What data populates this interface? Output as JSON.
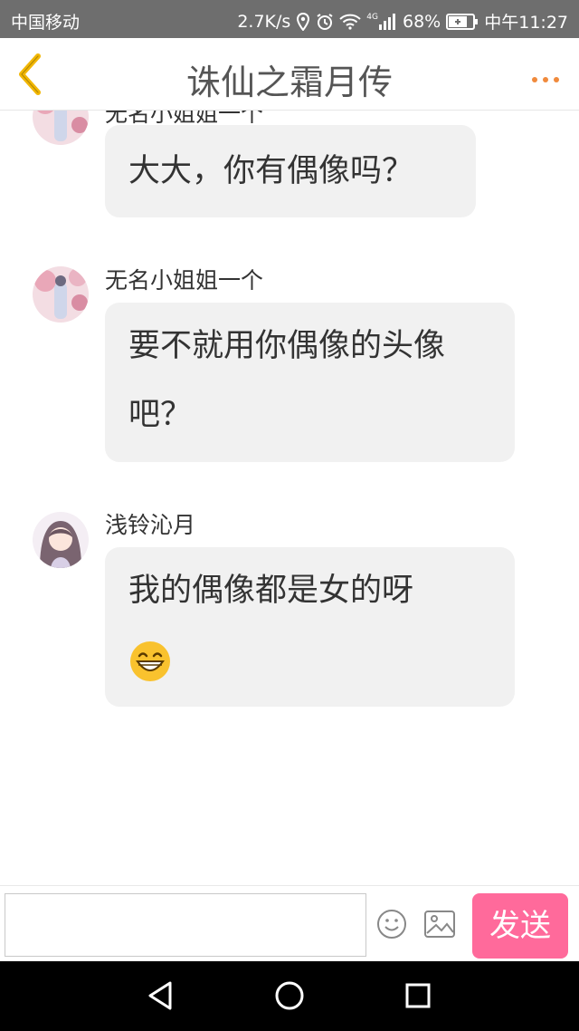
{
  "status_bar": {
    "carrier": "中国移动",
    "speed": "2.7K/s",
    "network": "4G",
    "battery": "68%",
    "time": "中午11:27"
  },
  "header": {
    "title": "诛仙之霜月传"
  },
  "messages": [
    {
      "sender": "无名小姐姐一个",
      "text": "大大，你有偶像吗？",
      "avatar": "avatar-pink-flowers"
    },
    {
      "sender": "无名小姐姐一个",
      "text": "要不就用你偶像的头像吧？",
      "avatar": "avatar-pink-flowers"
    },
    {
      "sender": "浅铃沁月",
      "text": "我的偶像都是女的呀",
      "avatar": "avatar-anime-girl",
      "emoji": "grinning-face-emoji"
    }
  ],
  "input": {
    "value": "",
    "send_label": "发送"
  },
  "colors": {
    "status_bar": "#6e6e6e",
    "back_arrow": "#f2b705",
    "more_dots": "#f08a3c",
    "bubble": "#f1f1f1",
    "send_button": "#ff6a9b"
  }
}
